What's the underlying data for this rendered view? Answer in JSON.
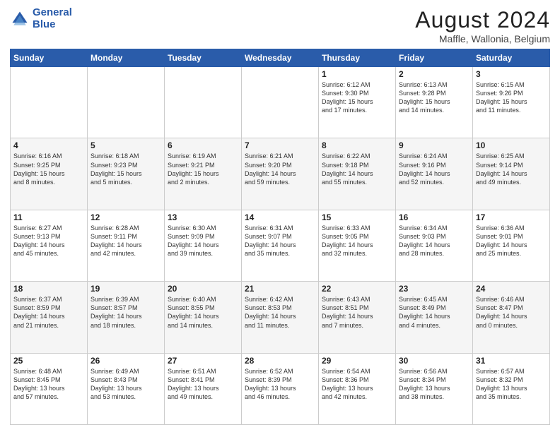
{
  "header": {
    "logo_line1": "General",
    "logo_line2": "Blue",
    "month_year": "August 2024",
    "location": "Maffle, Wallonia, Belgium"
  },
  "weekdays": [
    "Sunday",
    "Monday",
    "Tuesday",
    "Wednesday",
    "Thursday",
    "Friday",
    "Saturday"
  ],
  "weeks": [
    [
      {
        "day": "",
        "info": ""
      },
      {
        "day": "",
        "info": ""
      },
      {
        "day": "",
        "info": ""
      },
      {
        "day": "",
        "info": ""
      },
      {
        "day": "1",
        "info": "Sunrise: 6:12 AM\nSunset: 9:30 PM\nDaylight: 15 hours\nand 17 minutes."
      },
      {
        "day": "2",
        "info": "Sunrise: 6:13 AM\nSunset: 9:28 PM\nDaylight: 15 hours\nand 14 minutes."
      },
      {
        "day": "3",
        "info": "Sunrise: 6:15 AM\nSunset: 9:26 PM\nDaylight: 15 hours\nand 11 minutes."
      }
    ],
    [
      {
        "day": "4",
        "info": "Sunrise: 6:16 AM\nSunset: 9:25 PM\nDaylight: 15 hours\nand 8 minutes."
      },
      {
        "day": "5",
        "info": "Sunrise: 6:18 AM\nSunset: 9:23 PM\nDaylight: 15 hours\nand 5 minutes."
      },
      {
        "day": "6",
        "info": "Sunrise: 6:19 AM\nSunset: 9:21 PM\nDaylight: 15 hours\nand 2 minutes."
      },
      {
        "day": "7",
        "info": "Sunrise: 6:21 AM\nSunset: 9:20 PM\nDaylight: 14 hours\nand 59 minutes."
      },
      {
        "day": "8",
        "info": "Sunrise: 6:22 AM\nSunset: 9:18 PM\nDaylight: 14 hours\nand 55 minutes."
      },
      {
        "day": "9",
        "info": "Sunrise: 6:24 AM\nSunset: 9:16 PM\nDaylight: 14 hours\nand 52 minutes."
      },
      {
        "day": "10",
        "info": "Sunrise: 6:25 AM\nSunset: 9:14 PM\nDaylight: 14 hours\nand 49 minutes."
      }
    ],
    [
      {
        "day": "11",
        "info": "Sunrise: 6:27 AM\nSunset: 9:13 PM\nDaylight: 14 hours\nand 45 minutes."
      },
      {
        "day": "12",
        "info": "Sunrise: 6:28 AM\nSunset: 9:11 PM\nDaylight: 14 hours\nand 42 minutes."
      },
      {
        "day": "13",
        "info": "Sunrise: 6:30 AM\nSunset: 9:09 PM\nDaylight: 14 hours\nand 39 minutes."
      },
      {
        "day": "14",
        "info": "Sunrise: 6:31 AM\nSunset: 9:07 PM\nDaylight: 14 hours\nand 35 minutes."
      },
      {
        "day": "15",
        "info": "Sunrise: 6:33 AM\nSunset: 9:05 PM\nDaylight: 14 hours\nand 32 minutes."
      },
      {
        "day": "16",
        "info": "Sunrise: 6:34 AM\nSunset: 9:03 PM\nDaylight: 14 hours\nand 28 minutes."
      },
      {
        "day": "17",
        "info": "Sunrise: 6:36 AM\nSunset: 9:01 PM\nDaylight: 14 hours\nand 25 minutes."
      }
    ],
    [
      {
        "day": "18",
        "info": "Sunrise: 6:37 AM\nSunset: 8:59 PM\nDaylight: 14 hours\nand 21 minutes."
      },
      {
        "day": "19",
        "info": "Sunrise: 6:39 AM\nSunset: 8:57 PM\nDaylight: 14 hours\nand 18 minutes."
      },
      {
        "day": "20",
        "info": "Sunrise: 6:40 AM\nSunset: 8:55 PM\nDaylight: 14 hours\nand 14 minutes."
      },
      {
        "day": "21",
        "info": "Sunrise: 6:42 AM\nSunset: 8:53 PM\nDaylight: 14 hours\nand 11 minutes."
      },
      {
        "day": "22",
        "info": "Sunrise: 6:43 AM\nSunset: 8:51 PM\nDaylight: 14 hours\nand 7 minutes."
      },
      {
        "day": "23",
        "info": "Sunrise: 6:45 AM\nSunset: 8:49 PM\nDaylight: 14 hours\nand 4 minutes."
      },
      {
        "day": "24",
        "info": "Sunrise: 6:46 AM\nSunset: 8:47 PM\nDaylight: 14 hours\nand 0 minutes."
      }
    ],
    [
      {
        "day": "25",
        "info": "Sunrise: 6:48 AM\nSunset: 8:45 PM\nDaylight: 13 hours\nand 57 minutes."
      },
      {
        "day": "26",
        "info": "Sunrise: 6:49 AM\nSunset: 8:43 PM\nDaylight: 13 hours\nand 53 minutes."
      },
      {
        "day": "27",
        "info": "Sunrise: 6:51 AM\nSunset: 8:41 PM\nDaylight: 13 hours\nand 49 minutes."
      },
      {
        "day": "28",
        "info": "Sunrise: 6:52 AM\nSunset: 8:39 PM\nDaylight: 13 hours\nand 46 minutes."
      },
      {
        "day": "29",
        "info": "Sunrise: 6:54 AM\nSunset: 8:36 PM\nDaylight: 13 hours\nand 42 minutes."
      },
      {
        "day": "30",
        "info": "Sunrise: 6:56 AM\nSunset: 8:34 PM\nDaylight: 13 hours\nand 38 minutes."
      },
      {
        "day": "31",
        "info": "Sunrise: 6:57 AM\nSunset: 8:32 PM\nDaylight: 13 hours\nand 35 minutes."
      }
    ]
  ]
}
